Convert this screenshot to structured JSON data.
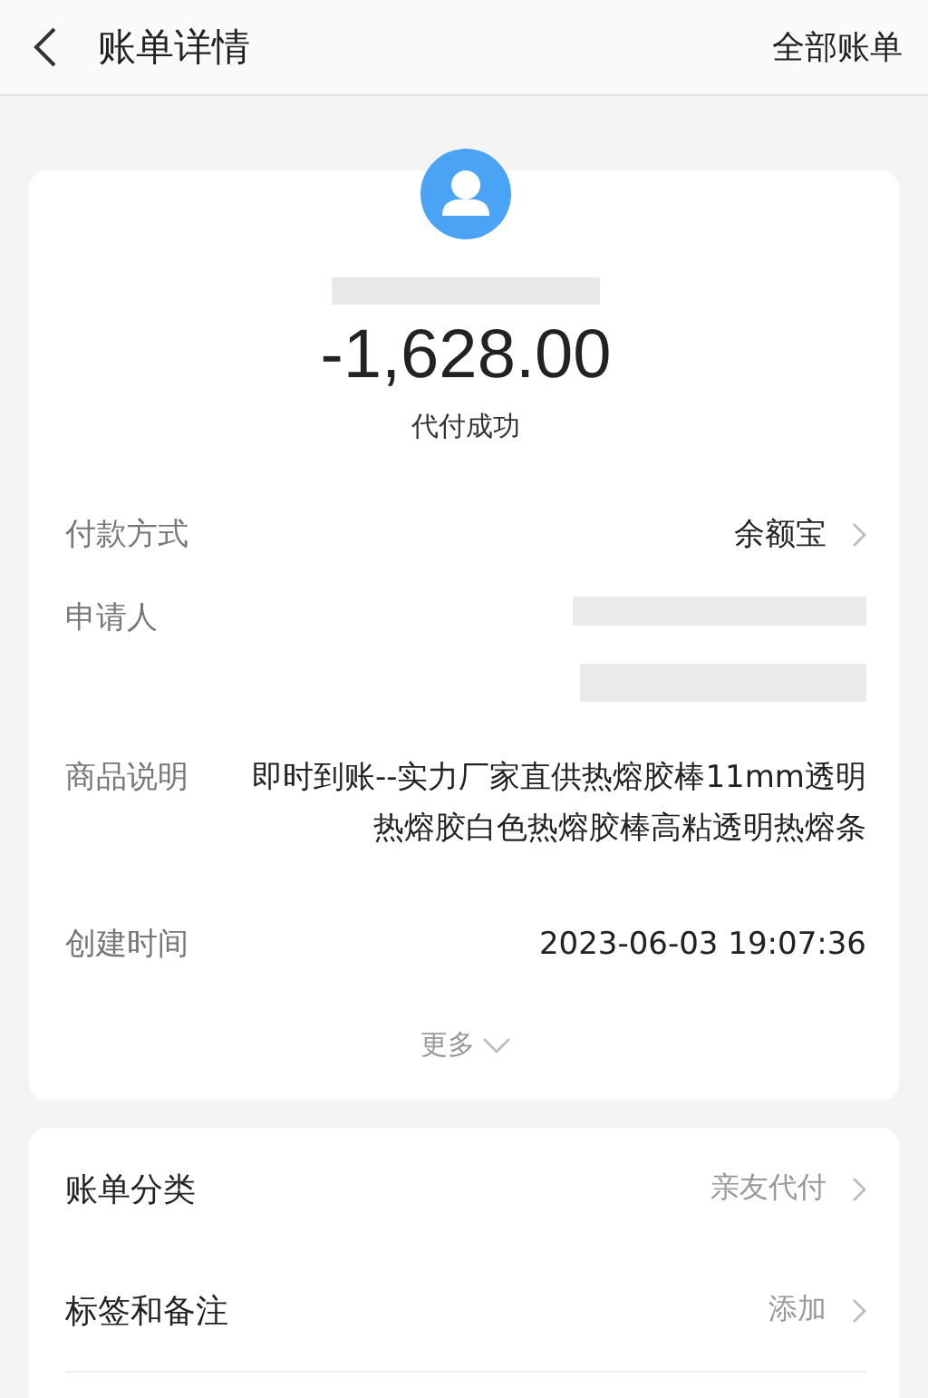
{
  "header": {
    "title": "账单详情",
    "action": "全部账单"
  },
  "summary": {
    "amount": "-1,628.00",
    "status": "代付成功"
  },
  "details": [
    {
      "kind": "link",
      "label": "付款方式",
      "value": "余额宝"
    },
    {
      "kind": "redacted",
      "label": "申请人"
    },
    {
      "kind": "text",
      "label": "商品说明",
      "value": "即时到账--实力厂家直供热熔胶棒11mm透明热熔胶白色热熔胶棒高粘透明热熔条"
    },
    {
      "kind": "text",
      "label": "创建时间",
      "value": "2023-06-03 19:07:36"
    }
  ],
  "more": "更多",
  "options": [
    {
      "label": "账单分类",
      "value": "亲友代付"
    },
    {
      "label": "标签和备注",
      "value": "添加"
    }
  ]
}
